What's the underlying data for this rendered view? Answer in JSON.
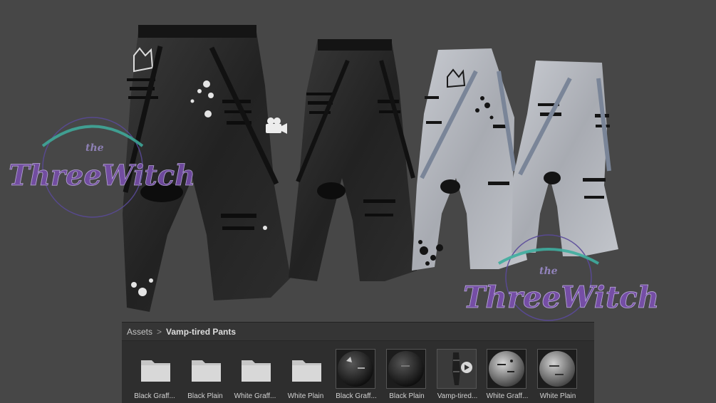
{
  "watermark": {
    "small_text": "the",
    "brand_text": "ThreeWitch"
  },
  "scene": {
    "camera_icon": "camera-icon"
  },
  "breadcrumb": {
    "root": "Assets",
    "separator": ">",
    "current": "Vamp-tired Pants"
  },
  "assets": [
    {
      "label": "Black Graff...",
      "kind": "folder"
    },
    {
      "label": "Black Plain",
      "kind": "folder"
    },
    {
      "label": "White Graff...",
      "kind": "folder"
    },
    {
      "label": "White Plain",
      "kind": "folder"
    },
    {
      "label": "Black Graff...",
      "kind": "material"
    },
    {
      "label": "Black Plain",
      "kind": "material"
    },
    {
      "label": "Vamp-tired...",
      "kind": "model"
    },
    {
      "label": "White Graff...",
      "kind": "material"
    },
    {
      "label": "White Plain",
      "kind": "material"
    }
  ],
  "colors": {
    "viewport_bg": "#474747",
    "panel_bg": "#2e2e2e",
    "watermark_purple": "#7a4fb0",
    "watermark_teal": "#3fae9f"
  }
}
